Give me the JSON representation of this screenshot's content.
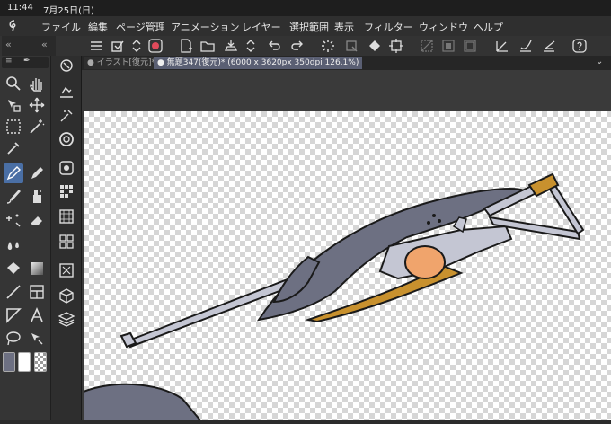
{
  "status": {
    "time": "11:44",
    "date": "7月25日(日)"
  },
  "menu": [
    "ファイル",
    "編集",
    "ページ管理",
    "アニメーション",
    "レイヤー",
    "選択範囲",
    "表示",
    "フィルター",
    "ウィンドウ",
    "ヘルプ"
  ],
  "tabs": [
    {
      "label": "イラスト[復元]*"
    },
    {
      "label": "無題347(復元)* (6000 x 3620px 350dpi 126.1%)"
    }
  ],
  "colors": {
    "main": "#6d7082",
    "sub": "#ffffff",
    "accent": "#4a6fa5"
  }
}
